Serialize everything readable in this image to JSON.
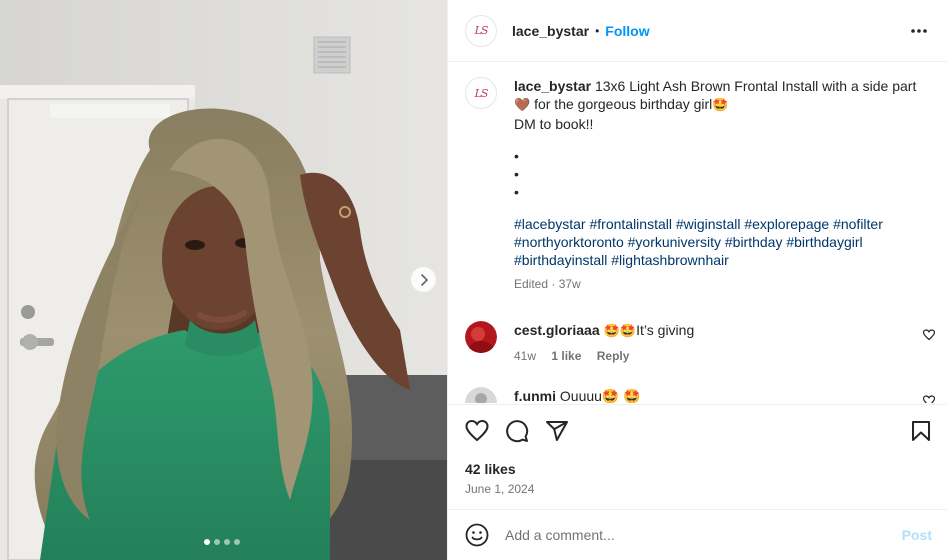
{
  "post": {
    "username": "lace_bystar",
    "separator": "•",
    "follow_label": "Follow",
    "avatar_text": "LS",
    "more_icon": "more-horizontal-icon"
  },
  "caption": {
    "username": "lace_bystar",
    "line1": " 13x6 Light Ash Brown Frontal Install with a side part",
    "line2_emoji": "🤎",
    "line2": " for the gorgeous birthday girl",
    "line2_end_emoji": "🤩",
    "line3": "DM to book!!",
    "bullets": [
      "•",
      "•",
      "•"
    ],
    "hashtags": "#lacebystar #frontalinstall #wiginstall #explorepage #nofilter #northyorktoronto #yorkuniversity #birthday #birthdaygirl #birthdayinstall #lightashbrownhair",
    "edited": "Edited",
    "dot": " · ",
    "age": "37w"
  },
  "comments": [
    {
      "username": "cest.gloriaaa",
      "emojis": " 🤩🤩",
      "text": "It’s giving",
      "age": "41w",
      "likes": "1 like",
      "reply": "Reply"
    },
    {
      "username": "f.unmi",
      "emojis": "",
      "text": " Ouuuu🤩 🤩"
    }
  ],
  "actions": {
    "likes": "42 likes",
    "date": "June 1, 2024"
  },
  "composer": {
    "placeholder": "Add a comment...",
    "post_label": "Post"
  },
  "carousel": {
    "total": 4,
    "current": 1
  },
  "colors": {
    "follow": "#0095f6",
    "hashtag": "#00376b",
    "muted": "#737373",
    "post_disabled": "#b2dffc",
    "brand_pink": "#c33a6a"
  }
}
